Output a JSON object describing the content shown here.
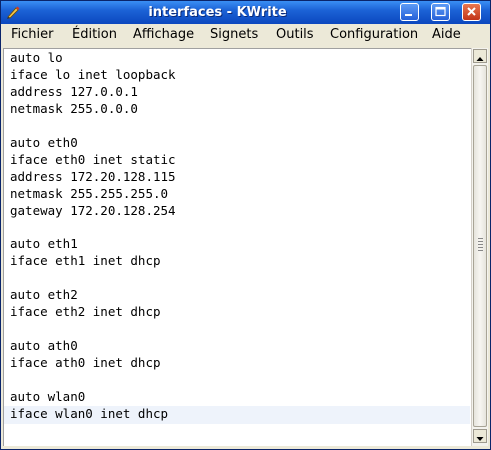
{
  "window": {
    "title": "interfaces - KWrite",
    "colors": {
      "titlebar": "#1c63d6",
      "close_button": "#c2351a",
      "current_line": "#eef3fb"
    }
  },
  "menu": {
    "items": [
      {
        "label": "Fichier"
      },
      {
        "label": "Édition"
      },
      {
        "label": "Affichage"
      },
      {
        "label": "Signets"
      },
      {
        "label": "Outils"
      },
      {
        "label": "Configuration"
      },
      {
        "label": "Aide"
      }
    ]
  },
  "editor": {
    "content": "auto lo\niface lo inet loopback\naddress 127.0.0.1\nnetmask 255.0.0.0\n\nauto eth0\niface eth0 inet static\naddress 172.20.128.115\nnetmask 255.255.255.0\ngateway 172.20.128.254\n\nauto eth1\niface eth1 inet dhcp\n\nauto eth2\niface eth2 inet dhcp\n\nauto ath0\niface ath0 inet dhcp\n\nauto wlan0\niface wlan0 inet dhcp"
  },
  "icons": {
    "app": "kwrite-pen-icon",
    "minimize": "minimize-icon",
    "maximize": "maximize-icon",
    "close": "close-icon",
    "scroll_up": "arrow-up-icon",
    "scroll_down": "arrow-down-icon"
  }
}
